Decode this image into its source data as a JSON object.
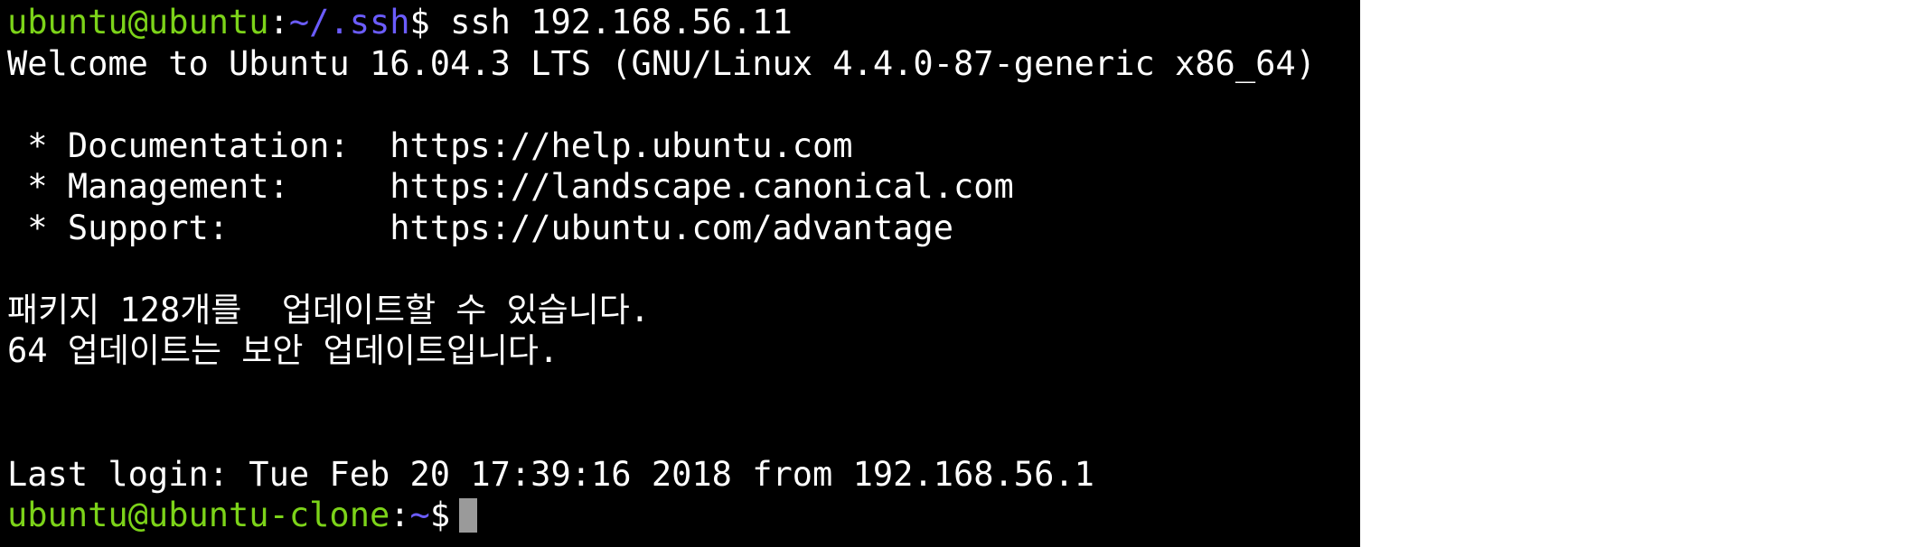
{
  "terminal": {
    "prompt1": {
      "user_host": "ubuntu@ubuntu",
      "colon": ":",
      "path": "~/.ssh",
      "symbol": "$",
      "command": " ssh 192.168.56.11"
    },
    "welcome": "Welcome to Ubuntu 16.04.3 LTS (GNU/Linux 4.4.0-87-generic x86_64)",
    "links": [
      " * Documentation:  https://help.ubuntu.com",
      " * Management:     https://landscape.canonical.com",
      " * Support:        https://ubuntu.com/advantage"
    ],
    "updates": [
      "패키지 128개를  업데이트할 수 있습니다.",
      "64 업데이트는 보안 업데이트입니다."
    ],
    "last_login": "Last login: Tue Feb 20 17:39:16 2018 from 192.168.56.1",
    "prompt2": {
      "user_host": "ubuntu@ubuntu-clone",
      "colon": ":",
      "path": "~",
      "symbol": "$"
    },
    "colors": {
      "background": "#000000",
      "text": "#ffffff",
      "user_host": "#7cd319",
      "path": "#6b5cff",
      "cursor": "#9a9a9a"
    }
  }
}
